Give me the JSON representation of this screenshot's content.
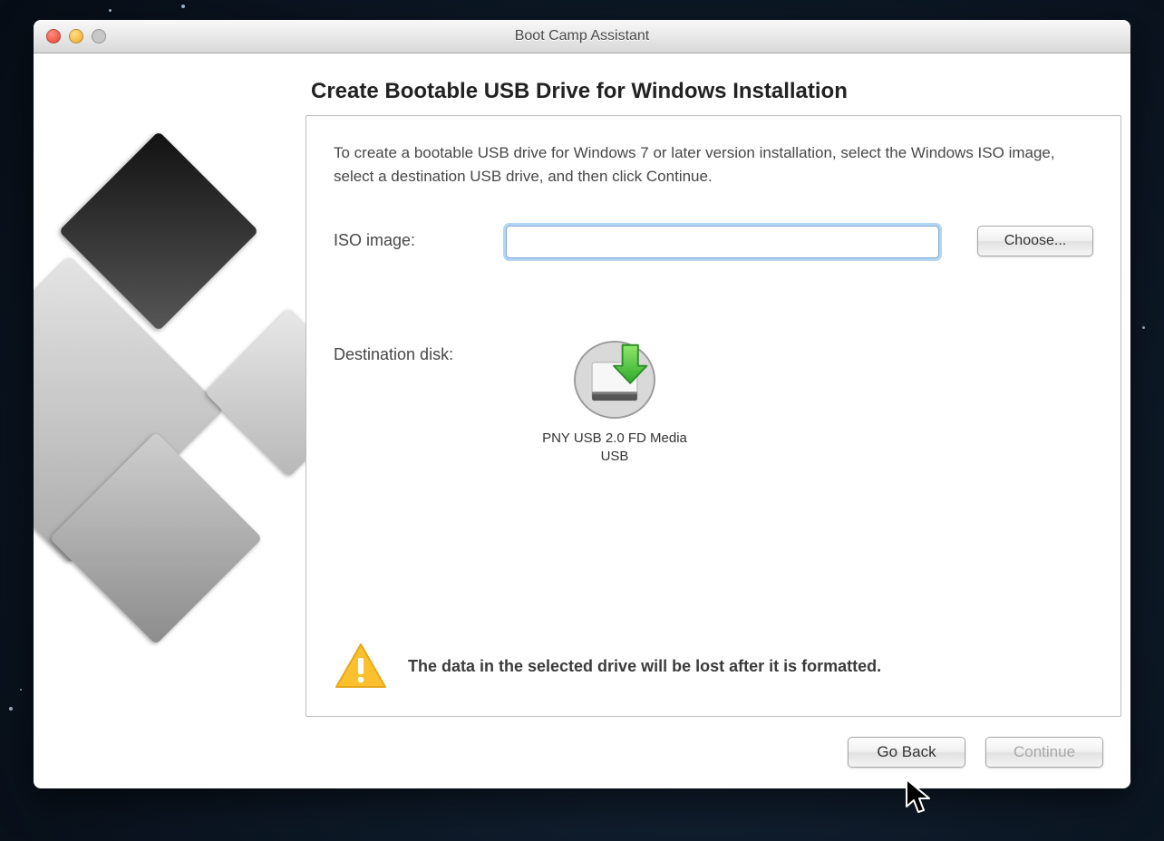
{
  "window": {
    "title": "Boot Camp Assistant"
  },
  "page": {
    "heading": "Create Bootable USB Drive for Windows Installation",
    "intro": "To create a bootable USB drive for Windows 7 or later version installation, select the Windows ISO image, select a destination USB drive, and then click Continue."
  },
  "iso": {
    "label": "ISO image:",
    "value": "",
    "choose_label": "Choose..."
  },
  "destination": {
    "label": "Destination disk:",
    "disk_name_line1": "PNY USB 2.0 FD Media",
    "disk_name_line2": "USB"
  },
  "warning": {
    "text": "The data in the selected drive will be lost after it is formatted."
  },
  "footer": {
    "back": "Go Back",
    "continue": "Continue"
  }
}
